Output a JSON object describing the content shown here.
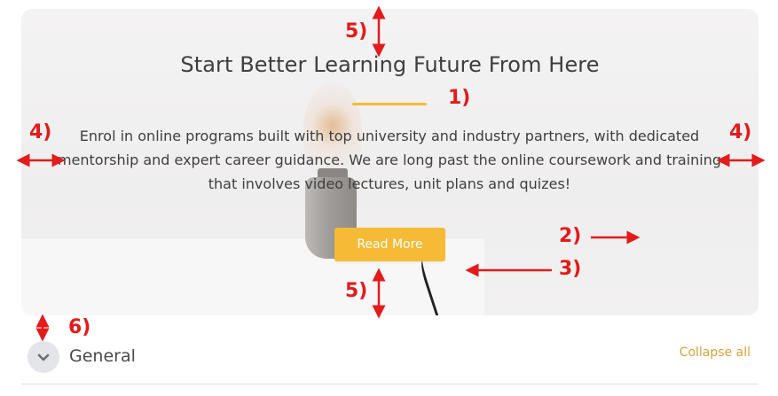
{
  "hero": {
    "title": "Start Better Learning Future From Here",
    "description": "Enrol in online programs built with top university and industry partners, with dedicated mentorship and expert career guidance. We are long past the online coursework and training that involves video lectures, unit plans and quizes!",
    "button_label": "Read More",
    "accent_color": "#f6bb35"
  },
  "annotations": {
    "label_1": "1)",
    "label_2": "2)",
    "label_3": "3)",
    "label_4_left": "4)",
    "label_4_right": "4)",
    "label_5_top": "5)",
    "label_5_bottom": "5)",
    "label_6": "6)",
    "color": "#e31b1b"
  },
  "section": {
    "title": "General",
    "collapse_label": "Collapse all",
    "toggle_icon": "chevron-down-icon"
  }
}
